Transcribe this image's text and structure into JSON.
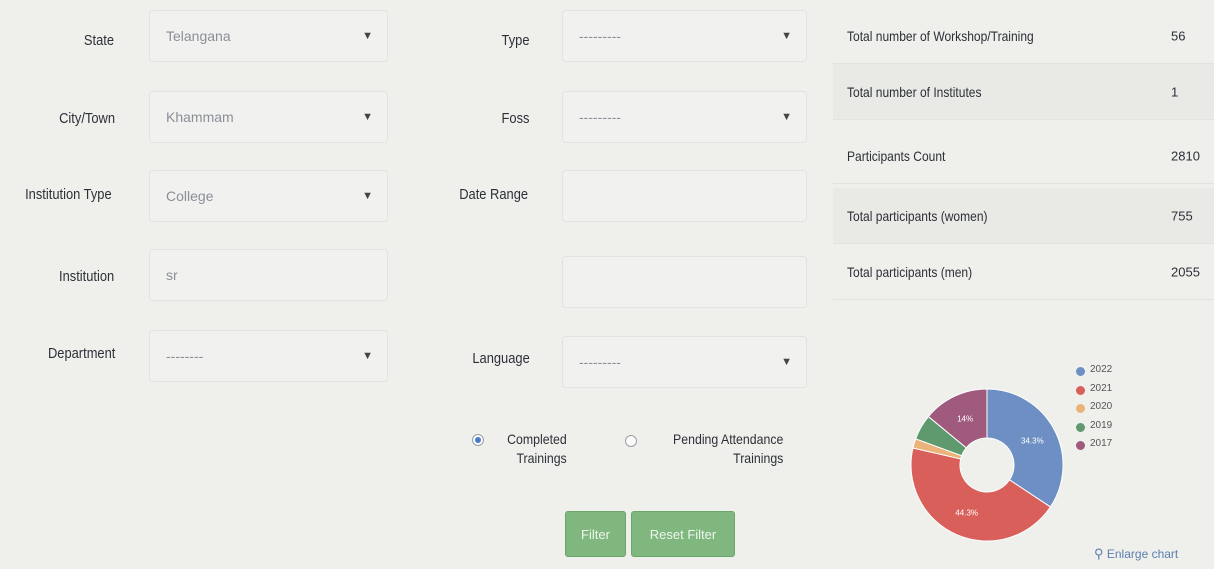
{
  "filters": {
    "state": {
      "label": "State",
      "value": "Telangana"
    },
    "city": {
      "label": "City/Town",
      "value": "Khammam"
    },
    "institution_type": {
      "label": "Institution Type",
      "value": "College"
    },
    "institution": {
      "label": "Institution",
      "value": "sr"
    },
    "department": {
      "label": "Department",
      "value": "--------"
    },
    "type": {
      "label": "Type",
      "value": "---------"
    },
    "foss": {
      "label": "Foss",
      "value": "---------"
    },
    "date_range": {
      "label": "Date Range",
      "value": ""
    },
    "language": {
      "label": "Language",
      "value": "---------"
    }
  },
  "radios": {
    "completed": {
      "line1": "Completed",
      "line2": "Trainings",
      "checked": true
    },
    "pending": {
      "line1": "Pending Attendance",
      "line2": "Trainings",
      "checked": false
    }
  },
  "buttons": {
    "filter": "Filter",
    "reset": "Reset Filter"
  },
  "stats": [
    {
      "label": "Total number of Workshop/Training",
      "value": "56"
    },
    {
      "label": "Total number of Institutes",
      "value": "1"
    },
    {
      "label": "Participants Count",
      "value": "2810"
    },
    {
      "label": "Total participants (women)",
      "value": "755"
    },
    {
      "label": "Total participants (men)",
      "value": "2055"
    }
  ],
  "chart_data": {
    "type": "pie",
    "categories": [
      "2022",
      "2021",
      "2020",
      "2019",
      "2017"
    ],
    "values": [
      34.3,
      44.3,
      2.0,
      5.4,
      14.0
    ],
    "colors": [
      "#6d8fc4",
      "#d9605a",
      "#ebb37a",
      "#5f9a6e",
      "#9f5a7e"
    ],
    "data_labels": [
      "34.3%",
      "44.3%",
      "",
      "",
      "14%"
    ],
    "legend_position": "right"
  },
  "enlarge_chart": "Enlarge chart",
  "icons": {
    "enlarge": "search-icon",
    "dropdown": "chevron-down-icon"
  }
}
